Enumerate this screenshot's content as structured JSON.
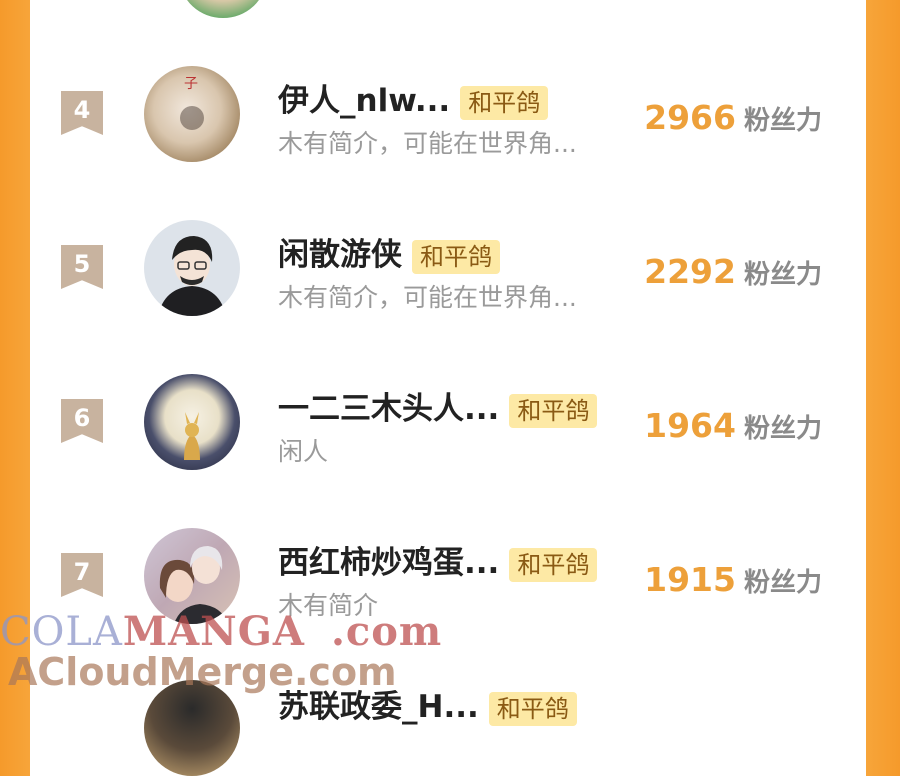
{
  "list": [
    {
      "rank": "4",
      "name": "伊人_nlw...",
      "tag": "和平鸽",
      "bio": "木有简介，可能在世界角...",
      "score": "2966",
      "unit": "粉丝力"
    },
    {
      "rank": "5",
      "name": "闲散游侠",
      "tag": "和平鸽",
      "bio": "木有简介，可能在世界角...",
      "score": "2292",
      "unit": "粉丝力"
    },
    {
      "rank": "6",
      "name": "一二三木头人...",
      "tag": "和平鸽",
      "bio": "闲人",
      "score": "1964",
      "unit": "粉丝力"
    },
    {
      "rank": "7",
      "name": "西红柿炒鸡蛋...",
      "tag": "和平鸽",
      "bio": "木有简介",
      "score": "1915",
      "unit": "粉丝力"
    }
  ],
  "partial_row": {
    "name": "苏联政委_H...",
    "tag": "和平鸽"
  },
  "watermark": {
    "line1_part1": "COLA",
    "line1_part2": "MANGA",
    "line1_part3": ".com",
    "line2": "ACloudMerge.com"
  },
  "colors": {
    "accent": "#eda03a",
    "badge": "#c8b39f",
    "tag_bg": "#fde9a5",
    "frame": "#f7a53a"
  }
}
